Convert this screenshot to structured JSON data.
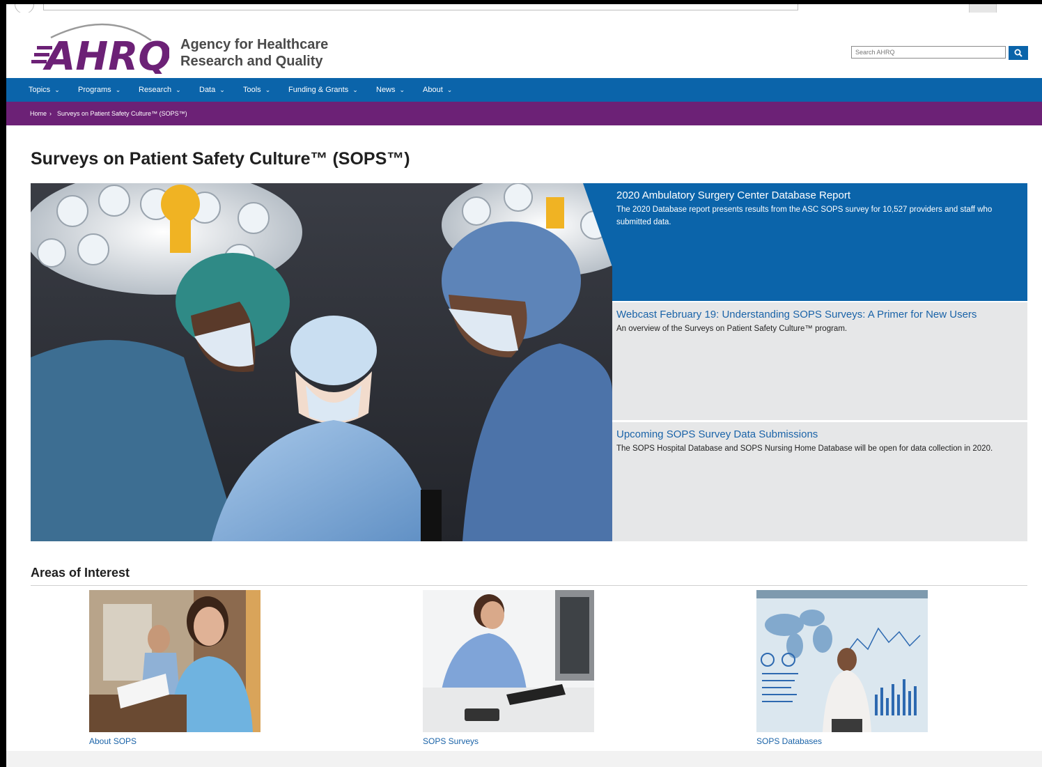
{
  "header": {
    "logo_text": "AHRQ",
    "agency_line1": "Agency for Healthcare",
    "agency_line2": "Research and Quality",
    "search_placeholder": "Search AHRQ"
  },
  "nav": {
    "items": [
      {
        "label": "Topics"
      },
      {
        "label": "Programs"
      },
      {
        "label": "Research"
      },
      {
        "label": "Data"
      },
      {
        "label": "Tools"
      },
      {
        "label": "Funding & Grants"
      },
      {
        "label": "News"
      },
      {
        "label": "About"
      }
    ]
  },
  "breadcrumb": {
    "home": "Home",
    "separator": "›",
    "current": "Surveys on Patient Safety Culture™ (SOPS™)"
  },
  "page": {
    "title": "Surveys on Patient Safety Culture™ (SOPS™)"
  },
  "features": [
    {
      "title": "2020 Ambulatory Surgery Center Database Report",
      "description": "The 2020 Database report presents results from the ASC SOPS survey for 10,527 providers and staff who submitted data."
    },
    {
      "title": "Webcast February 19: Understanding SOPS Surveys: A Primer for New Users",
      "description": "An overview of the Surveys on Patient Safety Culture™ program."
    },
    {
      "title": "Upcoming SOPS Survey Data Submissions",
      "description": "The SOPS Hospital Database and SOPS Nursing Home Database will be open for data collection in 2020."
    }
  ],
  "areas": {
    "title": "Areas of Interest",
    "cards": [
      {
        "caption": "About SOPS"
      },
      {
        "caption": "SOPS Surveys"
      },
      {
        "caption": "SOPS Databases"
      }
    ]
  },
  "colors": {
    "nav_blue": "#0b64aa",
    "breadcrumb_purple": "#6c2176",
    "feature_gray": "#e6e7e8",
    "link_blue": "#1a63a8",
    "logo_purple": "#6c2176"
  },
  "icons": {
    "search": "search-icon",
    "chevron": "chevron-down-icon"
  }
}
